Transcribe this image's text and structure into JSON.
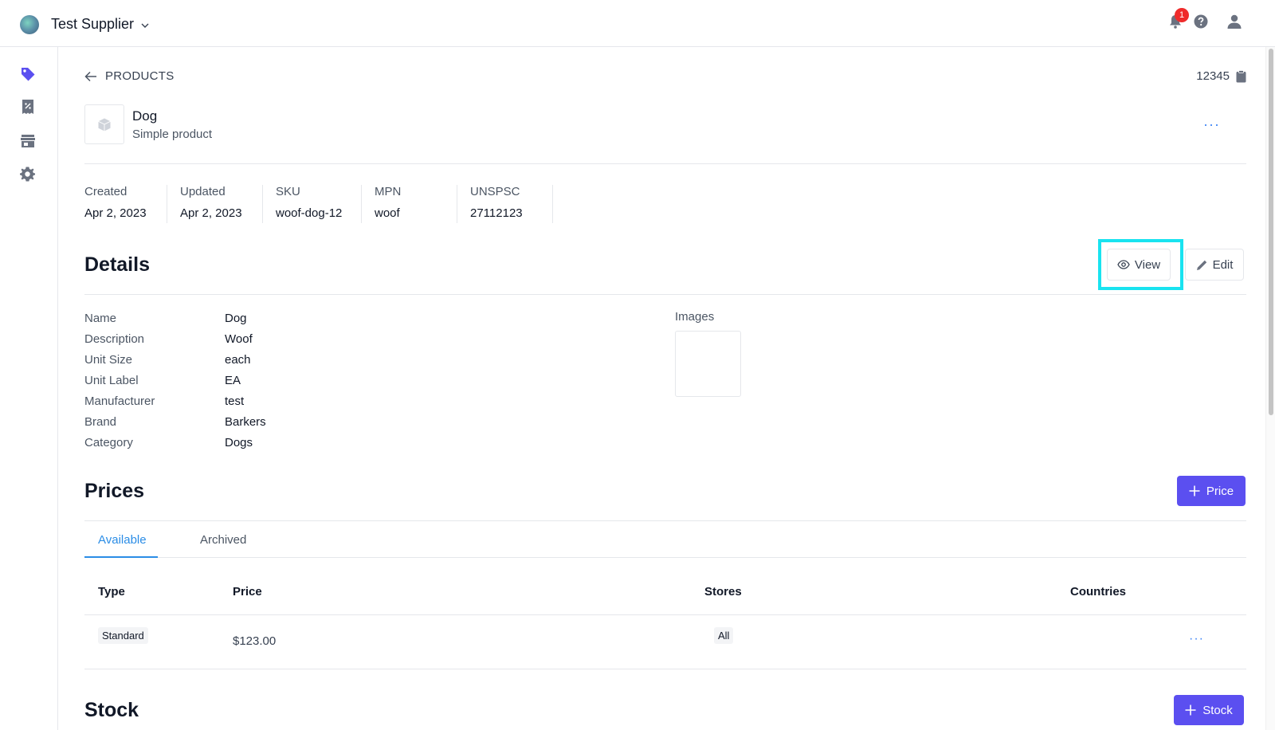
{
  "header": {
    "org_name": "Test Supplier",
    "notification_count": "1",
    "icons": [
      "logo-icon",
      "chevron-down-icon",
      "bell-icon",
      "help-icon",
      "user-icon"
    ]
  },
  "sidebar": {
    "items": [
      {
        "name": "products",
        "icon": "tag-icon"
      },
      {
        "name": "receipts",
        "icon": "receipt-discount-icon"
      },
      {
        "name": "stores",
        "icon": "storefront-icon"
      },
      {
        "name": "settings",
        "icon": "gear-icon"
      }
    ]
  },
  "breadcrumb": {
    "back_label": "PRODUCTS",
    "product_id": "12345"
  },
  "product": {
    "name": "Dog",
    "type": "Simple product",
    "more": "···"
  },
  "meta": [
    {
      "label": "Created",
      "value": "Apr 2, 2023"
    },
    {
      "label": "Updated",
      "value": "Apr 2, 2023"
    },
    {
      "label": "SKU",
      "value": "woof-dog-12"
    },
    {
      "label": "MPN",
      "value": "woof"
    },
    {
      "label": "UNSPSC",
      "value": "27112123"
    }
  ],
  "details": {
    "title": "Details",
    "view_label": "View",
    "edit_label": "Edit",
    "rows": [
      {
        "label": "Name",
        "value": "Dog"
      },
      {
        "label": "Description",
        "value": "Woof"
      },
      {
        "label": "Unit Size",
        "value": "each"
      },
      {
        "label": "Unit Label",
        "value": "EA"
      },
      {
        "label": "Manufacturer",
        "value": "test"
      },
      {
        "label": "Brand",
        "value": "Barkers"
      },
      {
        "label": "Category",
        "value": "Dogs"
      }
    ],
    "images_label": "Images"
  },
  "prices": {
    "title": "Prices",
    "add_label": "Price",
    "tabs": [
      "Available",
      "Archived"
    ],
    "columns": [
      "Type",
      "Price",
      "Stores",
      "Countries"
    ],
    "rows": [
      {
        "type": "Standard",
        "price": "$123.00",
        "stores": "All",
        "more": "···"
      }
    ]
  },
  "stock": {
    "title": "Stock",
    "add_label": "Stock"
  },
  "colors": {
    "primary": "#5b4ff0",
    "link": "#2b8de6",
    "highlight": "#19e3f0",
    "badge": "#ef2b2b"
  }
}
